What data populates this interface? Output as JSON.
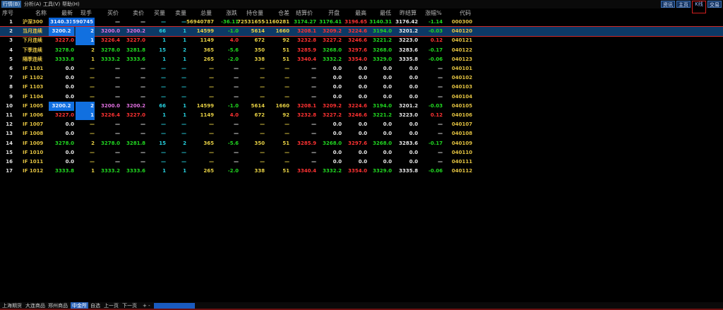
{
  "menu": [
    "行情(B)",
    "分析(A)",
    "工具(V)",
    "帮助(H)"
  ],
  "top_buttons": [
    "资讯",
    "主页",
    "K线",
    "交易"
  ],
  "columns": [
    "序号",
    "名称",
    "最新",
    "现手",
    "买价",
    "卖价",
    "买量",
    "卖量",
    "总量",
    "涨跌",
    "持仓量",
    "仓差",
    "结算价",
    "开盘",
    "最高",
    "最低",
    "昨结算",
    "涨幅%",
    "代码"
  ],
  "rows": [
    {
      "idx": "1",
      "name": "沪深300",
      "last": "3140.31",
      "vol": "590745",
      "bid": "—",
      "ask": "—",
      "bidq": "—",
      "askq": "—",
      "total": "56940787",
      "chg": "-36.11",
      "oi": "72531655",
      "oichg": "-1160281",
      "settle": "3174.27",
      "open": "3176.41",
      "high": "3196.65",
      "low": "3140.31",
      "prev": "3176.42",
      "pct": "-1.14",
      "code": "000300"
    },
    {
      "idx": "2",
      "name": "当月连续",
      "last": "3200.2",
      "vol": "2",
      "bid": "3200.0",
      "ask": "3200.2",
      "bidq": "66",
      "askq": "1",
      "total": "14599",
      "chg": "-1.0",
      "oi": "5614",
      "oichg": "1660",
      "settle": "3208.1",
      "open": "3209.2",
      "high": "3224.6",
      "low": "3194.0",
      "prev": "3201.2",
      "pct": "-0.03",
      "code": "040120"
    },
    {
      "idx": "3",
      "name": "下月连续",
      "last": "3227.0",
      "vol": "1",
      "bid": "3226.4",
      "ask": "3227.0",
      "bidq": "1",
      "askq": "1",
      "total": "1149",
      "chg": "4.0",
      "oi": "672",
      "oichg": "92",
      "settle": "3232.8",
      "open": "3227.2",
      "high": "3246.6",
      "low": "3221.2",
      "prev": "3223.0",
      "pct": "0.12",
      "code": "040121"
    },
    {
      "idx": "4",
      "name": "下季连续",
      "last": "3278.0",
      "vol": "2",
      "bid": "3278.0",
      "ask": "3281.8",
      "bidq": "15",
      "askq": "2",
      "total": "365",
      "chg": "-5.6",
      "oi": "350",
      "oichg": "51",
      "settle": "3285.9",
      "open": "3268.0",
      "high": "3297.6",
      "low": "3268.0",
      "prev": "3283.6",
      "pct": "-0.17",
      "code": "040122"
    },
    {
      "idx": "5",
      "name": "隔季连续",
      "last": "3333.8",
      "vol": "1",
      "bid": "3333.2",
      "ask": "3333.6",
      "bidq": "1",
      "askq": "1",
      "total": "265",
      "chg": "-2.0",
      "oi": "338",
      "oichg": "51",
      "settle": "3340.4",
      "open": "3332.2",
      "high": "3354.0",
      "low": "3329.0",
      "prev": "3335.8",
      "pct": "-0.06",
      "code": "040123"
    },
    {
      "idx": "6",
      "name": "IF 1101",
      "last": "0.0",
      "vol": "—",
      "bid": "—",
      "ask": "—",
      "bidq": "—",
      "askq": "—",
      "total": "—",
      "chg": "—",
      "oi": "—",
      "oichg": "—",
      "settle": "—",
      "open": "0.0",
      "high": "0.0",
      "low": "0.0",
      "prev": "0.0",
      "pct": "—",
      "code": "040101"
    },
    {
      "idx": "7",
      "name": "IF 1102",
      "last": "0.0",
      "vol": "—",
      "bid": "—",
      "ask": "—",
      "bidq": "—",
      "askq": "—",
      "total": "—",
      "chg": "—",
      "oi": "—",
      "oichg": "—",
      "settle": "—",
      "open": "0.0",
      "high": "0.0",
      "low": "0.0",
      "prev": "0.0",
      "pct": "—",
      "code": "040102"
    },
    {
      "idx": "8",
      "name": "IF 1103",
      "last": "0.0",
      "vol": "—",
      "bid": "—",
      "ask": "—",
      "bidq": "—",
      "askq": "—",
      "total": "—",
      "chg": "—",
      "oi": "—",
      "oichg": "—",
      "settle": "—",
      "open": "0.0",
      "high": "0.0",
      "low": "0.0",
      "prev": "0.0",
      "pct": "—",
      "code": "040103"
    },
    {
      "idx": "9",
      "name": "IF 1104",
      "last": "0.0",
      "vol": "—",
      "bid": "—",
      "ask": "—",
      "bidq": "—",
      "askq": "—",
      "total": "—",
      "chg": "—",
      "oi": "—",
      "oichg": "—",
      "settle": "—",
      "open": "0.0",
      "high": "0.0",
      "low": "0.0",
      "prev": "0.0",
      "pct": "—",
      "code": "040104"
    },
    {
      "idx": "10",
      "name": "IF 1005",
      "last": "3200.2",
      "vol": "2",
      "bid": "3200.0",
      "ask": "3200.2",
      "bidq": "66",
      "askq": "1",
      "total": "14599",
      "chg": "-1.0",
      "oi": "5614",
      "oichg": "1660",
      "settle": "3208.1",
      "open": "3209.2",
      "high": "3224.6",
      "low": "3194.0",
      "prev": "3201.2",
      "pct": "-0.03",
      "code": "040105"
    },
    {
      "idx": "11",
      "name": "IF 1006",
      "last": "3227.0",
      "vol": "1",
      "bid": "3226.4",
      "ask": "3227.0",
      "bidq": "1",
      "askq": "1",
      "total": "1149",
      "chg": "4.0",
      "oi": "672",
      "oichg": "92",
      "settle": "3232.8",
      "open": "3227.2",
      "high": "3246.6",
      "low": "3221.2",
      "prev": "3223.0",
      "pct": "0.12",
      "code": "040106"
    },
    {
      "idx": "12",
      "name": "IF 1007",
      "last": "0.0",
      "vol": "—",
      "bid": "—",
      "ask": "—",
      "bidq": "—",
      "askq": "—",
      "total": "—",
      "chg": "—",
      "oi": "—",
      "oichg": "—",
      "settle": "—",
      "open": "0.0",
      "high": "0.0",
      "low": "0.0",
      "prev": "0.0",
      "pct": "—",
      "code": "040107"
    },
    {
      "idx": "13",
      "name": "IF 1008",
      "last": "0.0",
      "vol": "—",
      "bid": "—",
      "ask": "—",
      "bidq": "—",
      "askq": "—",
      "total": "—",
      "chg": "—",
      "oi": "—",
      "oichg": "—",
      "settle": "—",
      "open": "0.0",
      "high": "0.0",
      "low": "0.0",
      "prev": "0.0",
      "pct": "—",
      "code": "040108"
    },
    {
      "idx": "14",
      "name": "IF 1009",
      "last": "3278.0",
      "vol": "2",
      "bid": "3278.0",
      "ask": "3281.8",
      "bidq": "15",
      "askq": "2",
      "total": "365",
      "chg": "-5.6",
      "oi": "350",
      "oichg": "51",
      "settle": "3285.9",
      "open": "3268.0",
      "high": "3297.6",
      "low": "3268.0",
      "prev": "3283.6",
      "pct": "-0.17",
      "code": "040109"
    },
    {
      "idx": "15",
      "name": "IF 1010",
      "last": "0.0",
      "vol": "—",
      "bid": "—",
      "ask": "—",
      "bidq": "—",
      "askq": "—",
      "total": "—",
      "chg": "—",
      "oi": "—",
      "oichg": "—",
      "settle": "—",
      "open": "0.0",
      "high": "0.0",
      "low": "0.0",
      "prev": "0.0",
      "pct": "—",
      "code": "040110"
    },
    {
      "idx": "16",
      "name": "IF 1011",
      "last": "0.0",
      "vol": "—",
      "bid": "—",
      "ask": "—",
      "bidq": "—",
      "askq": "—",
      "total": "—",
      "chg": "—",
      "oi": "—",
      "oichg": "—",
      "settle": "—",
      "open": "0.0",
      "high": "0.0",
      "low": "0.0",
      "prev": "0.0",
      "pct": "—",
      "code": "040111"
    },
    {
      "idx": "17",
      "name": "IF 1012",
      "last": "3333.8",
      "vol": "1",
      "bid": "3333.2",
      "ask": "3333.6",
      "bidq": "1",
      "askq": "1",
      "total": "265",
      "chg": "-2.0",
      "oi": "338",
      "oichg": "51",
      "settle": "3340.4",
      "open": "3332.2",
      "high": "3354.0",
      "low": "3329.0",
      "prev": "3335.8",
      "pct": "-0.06",
      "code": "040112"
    }
  ],
  "bottom_tabs": [
    "上海期货",
    "大连商品",
    "郑州商品",
    "中金所",
    "自选",
    "上一页",
    "下一页",
    "+ -"
  ],
  "active_tab": "中金所",
  "colors": {
    "up": "#ff3232",
    "down": "#21d821",
    "flat": "#e8e8e8",
    "name": "#e0c040",
    "selected_bg": "#0c3966"
  }
}
